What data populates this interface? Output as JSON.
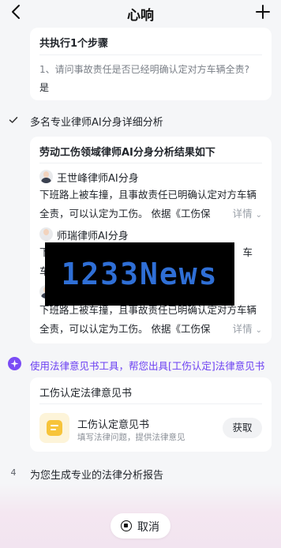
{
  "header": {
    "title": "心响",
    "back_icon": "chevron-left-icon",
    "add_icon": "plus-icon"
  },
  "steps_card": {
    "title": "共执行1个步骤",
    "question": "1、请问事故责任是否已经明确认定对方车辆全责?",
    "answer": "是"
  },
  "analysis_section": {
    "label": "多名专业律师AI分身详细分析",
    "card_title": "劳动工伤领域律师AI分身分析结果如下",
    "lawyers": [
      {
        "name": "王世峰律师AI分身",
        "line1": "下班路上被车撞，且事故责任已明确认定对方车辆",
        "line2": "全责，可以认定为工伤。 依据《工伤保",
        "more": "详情"
      },
      {
        "name": "师瑞律师AI分身",
        "line1": "下",
        "line2": "车",
        "line1_end": "车",
        "more": ""
      },
      {
        "name": "",
        "line1": "下班路上被车撞，且事故责任已明确认定对方车辆",
        "line2": "全责，可以认定为工伤。 依据《工伤保",
        "more": "详情"
      }
    ]
  },
  "tool_section": {
    "label": "使用法律意见书工具，帮您出具[工伤认定]法律意见书",
    "accent_color": "#6b3ff2"
  },
  "opinion_card": {
    "title": "工伤认定法律意见书",
    "doc_title": "工伤认定意见书",
    "doc_sub": "填写法律问题，提供法律意见",
    "get_label": "获取"
  },
  "report_step": {
    "number": "4",
    "label": "为您生成专业的法律分析报告"
  },
  "footer": {
    "cancel_label": "取消"
  },
  "watermark": {
    "text": "1233News"
  }
}
